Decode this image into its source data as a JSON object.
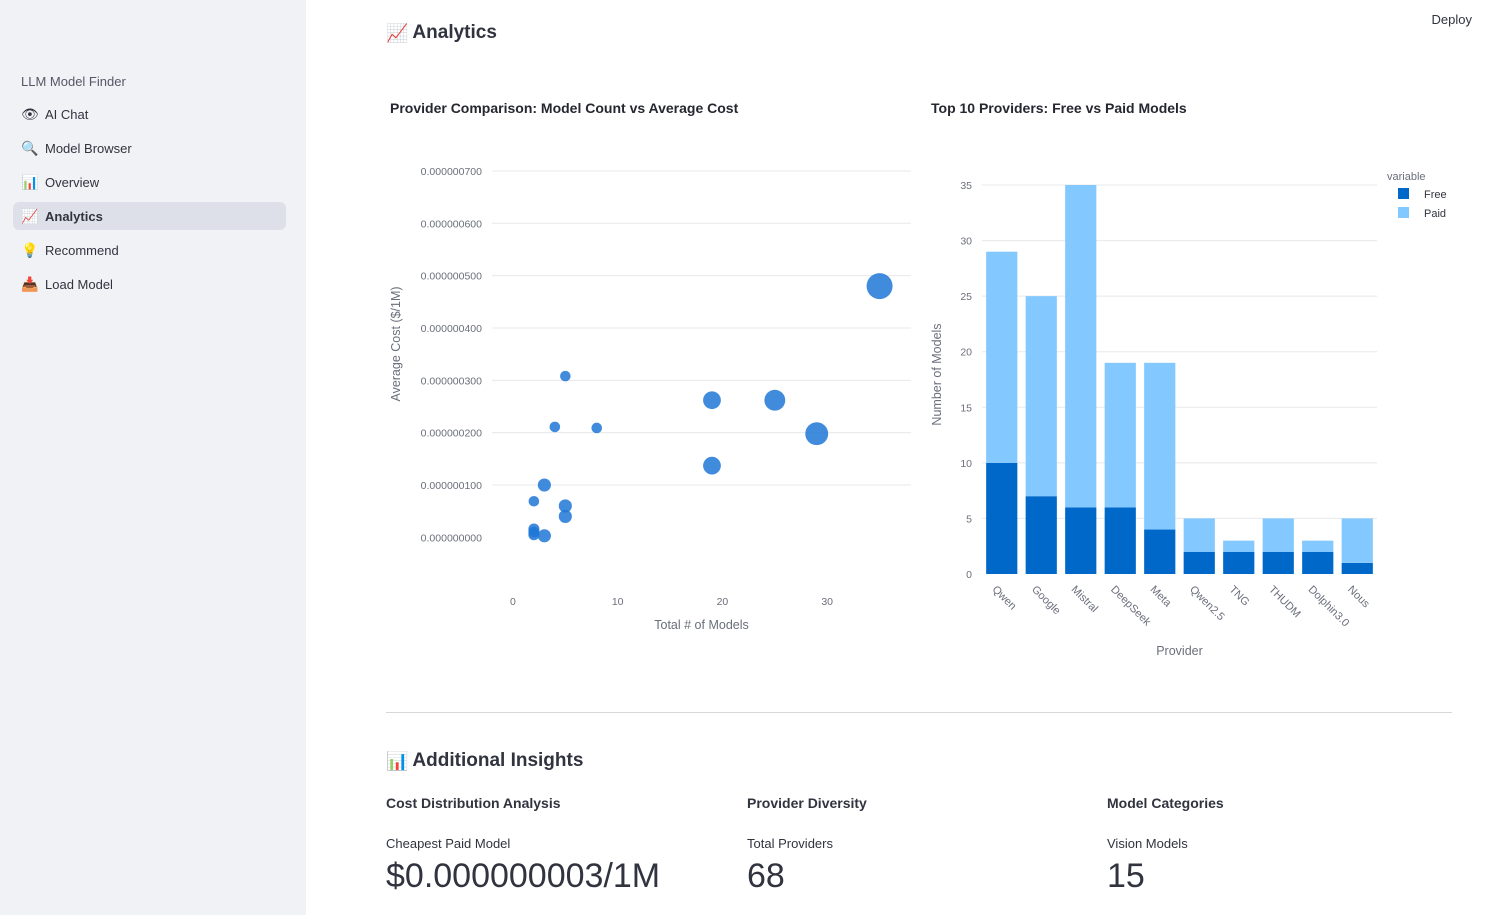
{
  "sidebar": {
    "heading": "LLM Model Finder",
    "items": [
      {
        "label": "AI Chat",
        "icon": "eye-icon",
        "glyph": "👁"
      },
      {
        "label": "Model Browser",
        "icon": "magnifier-icon",
        "glyph": "🔍"
      },
      {
        "label": "Overview",
        "icon": "bar-chart-icon",
        "glyph": "📊"
      },
      {
        "label": "Analytics",
        "icon": "trending-chart-icon",
        "glyph": "📈"
      },
      {
        "label": "Recommend",
        "icon": "lightbulb-icon",
        "glyph": "💡"
      },
      {
        "label": "Load Model",
        "icon": "inbox-tray-icon",
        "glyph": "📥"
      }
    ],
    "active_index": 3
  },
  "header": {
    "deploy_label": "Deploy"
  },
  "page": {
    "title": "Analytics",
    "title_glyph": "📈"
  },
  "chart_data": [
    {
      "type": "scatter",
      "title": "Provider Comparison: Model Count vs Average Cost",
      "xlabel": "Total # of Models",
      "ylabel": "Average Cost ($/1M)",
      "x_ticks": [
        "0",
        "10",
        "20",
        "30"
      ],
      "x_tick_values": [
        0,
        10,
        20,
        30
      ],
      "y_ticks": [
        "0.000000000",
        "0.000000100",
        "0.000000200",
        "0.000000300",
        "0.000000400",
        "0.000000500",
        "0.000000600",
        "0.000000700"
      ],
      "y_tick_values": [
        0,
        1e-07,
        2e-07,
        3e-07,
        4e-07,
        5e-07,
        6e-07,
        7e-07
      ],
      "xlim": [
        -2,
        38
      ],
      "ylim": [
        -7e-08,
        7.4e-07
      ],
      "grid": true,
      "color": "#1f77d6",
      "points": [
        {
          "x": 35,
          "y": 4.8e-07,
          "size": 35
        },
        {
          "x": 29,
          "y": 1.98e-07,
          "size": 29
        },
        {
          "x": 25,
          "y": 2.62e-07,
          "size": 25
        },
        {
          "x": 19,
          "y": 2.62e-07,
          "size": 19
        },
        {
          "x": 19,
          "y": 1.37e-07,
          "size": 19
        },
        {
          "x": 5,
          "y": 3.08e-07,
          "size": 5
        },
        {
          "x": 4,
          "y": 2.11e-07,
          "size": 5
        },
        {
          "x": 8,
          "y": 2.09e-07,
          "size": 5
        },
        {
          "x": 3,
          "y": 1e-07,
          "size": 10
        },
        {
          "x": 2,
          "y": 6.9e-08,
          "size": 5
        },
        {
          "x": 5,
          "y": 6e-08,
          "size": 10
        },
        {
          "x": 5,
          "y": 4e-08,
          "size": 10
        },
        {
          "x": 2,
          "y": 1.6e-08,
          "size": 6
        },
        {
          "x": 2,
          "y": 1e-08,
          "size": 6
        },
        {
          "x": 2,
          "y": 5e-09,
          "size": 6
        },
        {
          "x": 3,
          "y": 3e-09,
          "size": 10
        }
      ]
    },
    {
      "type": "bar",
      "stacked": true,
      "title": "Top 10 Providers: Free vs Paid Models",
      "xlabel": "Provider",
      "ylabel": "Number of Models",
      "categories": [
        "Qwen",
        "Google",
        "Mistral",
        "DeepSeek",
        "Meta",
        "Qwen2.5",
        "TNG",
        "THUDM",
        "Dolphin3.0",
        "Nous"
      ],
      "series": [
        {
          "name": "Free",
          "color": "#0068c9",
          "values": [
            10,
            7,
            6,
            6,
            4,
            2,
            2,
            2,
            2,
            1
          ]
        },
        {
          "name": "Paid",
          "color": "#83c9ff",
          "values": [
            19,
            18,
            29,
            13,
            15,
            3,
            1,
            3,
            1,
            4
          ]
        }
      ],
      "legend_title": "variable",
      "legend_position": "top-right",
      "y_ticks": [
        "0",
        "5",
        "10",
        "15",
        "20",
        "25",
        "30",
        "35"
      ],
      "y_tick_values": [
        0,
        5,
        10,
        15,
        20,
        25,
        30,
        35
      ],
      "ylim": [
        0,
        35
      ],
      "grid": true
    }
  ],
  "insights": {
    "title": "Additional Insights",
    "title_glyph": "📊",
    "columns": [
      {
        "title": "Cost Distribution Analysis",
        "label": "Cheapest Paid Model",
        "value": "$0.000000003/1M"
      },
      {
        "title": "Provider Diversity",
        "label": "Total Providers",
        "value": "68"
      },
      {
        "title": "Model Categories",
        "label": "Vision Models",
        "value": "15"
      }
    ]
  }
}
